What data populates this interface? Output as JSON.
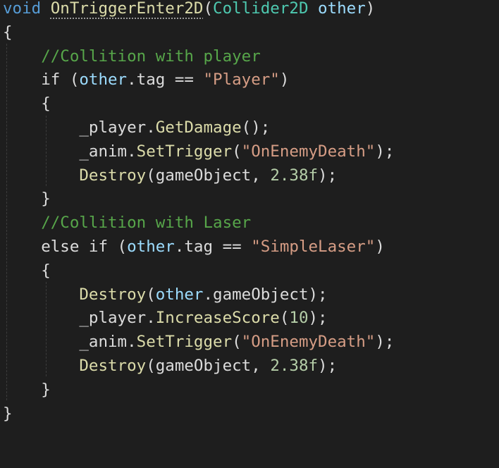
{
  "editor": {
    "theme": "dark",
    "colors": {
      "background": "#1e1e1e",
      "keyword": "#569cd6",
      "method": "#dcdcaa",
      "type": "#4ec9b0",
      "parameter": "#9cdcfe",
      "string": "#d69d85",
      "comment": "#57a64a",
      "number": "#b5cea8",
      "plain": "#dcdcdc"
    },
    "lines": [
      {
        "tokens": [
          {
            "t": "void",
            "k": "kw"
          },
          {
            "t": " ",
            "k": "plain"
          },
          {
            "t": "OnTriggerEnter2D",
            "k": "fn",
            "dotted": true
          },
          {
            "t": "(",
            "k": "plain"
          },
          {
            "t": "Collider2D",
            "k": "cls"
          },
          {
            "t": " ",
            "k": "plain"
          },
          {
            "t": "other",
            "k": "param"
          },
          {
            "t": ")",
            "k": "plain"
          }
        ]
      },
      {
        "tokens": [
          {
            "t": "{",
            "k": "plain"
          }
        ]
      },
      {
        "tokens": [
          {
            "t": "    ",
            "k": "plain"
          },
          {
            "t": "//Collition with player",
            "k": "cmt"
          }
        ]
      },
      {
        "tokens": [
          {
            "t": "    ",
            "k": "plain"
          },
          {
            "t": "if",
            "k": "plain"
          },
          {
            "t": " (",
            "k": "plain"
          },
          {
            "t": "other",
            "k": "param"
          },
          {
            "t": ".tag == ",
            "k": "plain"
          },
          {
            "t": "\"Player\"",
            "k": "str"
          },
          {
            "t": ")",
            "k": "plain"
          }
        ]
      },
      {
        "tokens": [
          {
            "t": "    ",
            "k": "plain"
          },
          {
            "t": "{",
            "k": "plain"
          }
        ]
      },
      {
        "tokens": [
          {
            "t": "        ",
            "k": "plain"
          },
          {
            "t": "_player.",
            "k": "plain"
          },
          {
            "t": "GetDamage",
            "k": "fn"
          },
          {
            "t": "();",
            "k": "plain"
          }
        ]
      },
      {
        "tokens": [
          {
            "t": "        ",
            "k": "plain"
          },
          {
            "t": "_anim.",
            "k": "plain"
          },
          {
            "t": "SetTrigger",
            "k": "fn"
          },
          {
            "t": "(",
            "k": "plain"
          },
          {
            "t": "\"OnEnemyDeath\"",
            "k": "str"
          },
          {
            "t": ");",
            "k": "plain"
          }
        ]
      },
      {
        "tokens": [
          {
            "t": "        ",
            "k": "plain"
          },
          {
            "t": "Destroy",
            "k": "fn"
          },
          {
            "t": "(gameObject, ",
            "k": "plain"
          },
          {
            "t": "2.38f",
            "k": "num"
          },
          {
            "t": ");",
            "k": "plain"
          }
        ]
      },
      {
        "tokens": [
          {
            "t": "    ",
            "k": "plain"
          },
          {
            "t": "}",
            "k": "plain"
          }
        ]
      },
      {
        "tokens": [
          {
            "t": "    ",
            "k": "plain"
          },
          {
            "t": "//Collition with Laser",
            "k": "cmt"
          }
        ]
      },
      {
        "tokens": [
          {
            "t": "    ",
            "k": "plain"
          },
          {
            "t": "else if",
            "k": "plain"
          },
          {
            "t": " (",
            "k": "plain"
          },
          {
            "t": "other",
            "k": "param"
          },
          {
            "t": ".tag == ",
            "k": "plain"
          },
          {
            "t": "\"SimpleLaser\"",
            "k": "str"
          },
          {
            "t": ")",
            "k": "plain"
          }
        ]
      },
      {
        "tokens": [
          {
            "t": "    ",
            "k": "plain"
          },
          {
            "t": "{",
            "k": "plain"
          }
        ]
      },
      {
        "tokens": [
          {
            "t": "        ",
            "k": "plain"
          },
          {
            "t": "Destroy",
            "k": "fn"
          },
          {
            "t": "(",
            "k": "plain"
          },
          {
            "t": "other",
            "k": "param"
          },
          {
            "t": ".gameObject);",
            "k": "plain"
          }
        ]
      },
      {
        "tokens": [
          {
            "t": "        ",
            "k": "plain"
          },
          {
            "t": "_player.",
            "k": "plain"
          },
          {
            "t": "IncreaseScore",
            "k": "fn"
          },
          {
            "t": "(",
            "k": "plain"
          },
          {
            "t": "10",
            "k": "num"
          },
          {
            "t": ");",
            "k": "plain"
          }
        ]
      },
      {
        "tokens": [
          {
            "t": "        ",
            "k": "plain"
          },
          {
            "t": "_anim.",
            "k": "plain"
          },
          {
            "t": "SetTrigger",
            "k": "fn"
          },
          {
            "t": "(",
            "k": "plain"
          },
          {
            "t": "\"OnEnemyDeath\"",
            "k": "str"
          },
          {
            "t": ");",
            "k": "plain"
          }
        ]
      },
      {
        "tokens": [
          {
            "t": "        ",
            "k": "plain"
          },
          {
            "t": "Destroy",
            "k": "fn"
          },
          {
            "t": "(gameObject, ",
            "k": "plain"
          },
          {
            "t": "2.38f",
            "k": "num"
          },
          {
            "t": ");",
            "k": "plain"
          }
        ]
      },
      {
        "tokens": [
          {
            "t": "    ",
            "k": "plain"
          },
          {
            "t": "}",
            "k": "plain"
          }
        ]
      },
      {
        "tokens": [
          {
            "t": "}",
            "k": "plain"
          }
        ]
      }
    ]
  }
}
